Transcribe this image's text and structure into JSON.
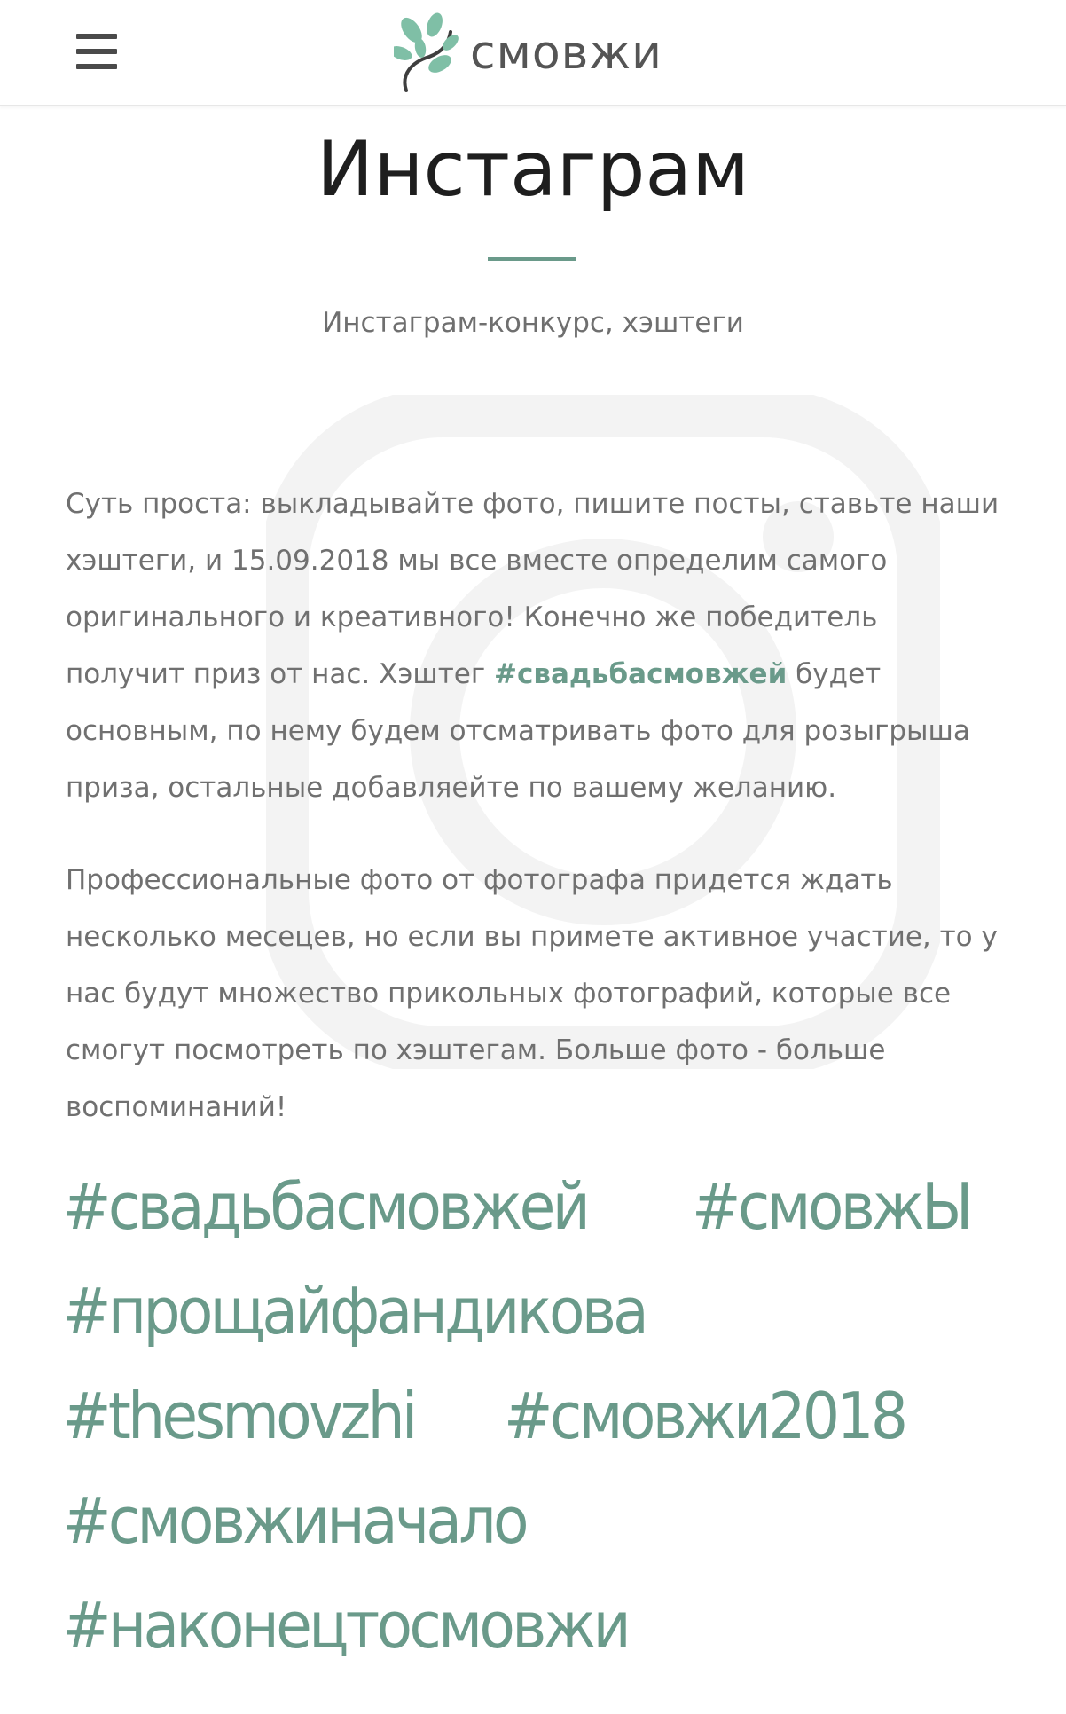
{
  "header": {
    "brand_name": "смовжи",
    "menu_icon": "hamburger-menu-icon",
    "logo_icon": "leaf-branch-icon"
  },
  "page": {
    "title": "Инстаграм",
    "subtitle": "Инстаграм-конкурс, хэштеги",
    "watermark_icon": "instagram-icon"
  },
  "intro": {
    "part1": "Суть проста: выкладывайте фото, пишите посты, ставьте наши хэштеги, и 15.09.2018 мы все вместе определим самого оригинального и креативного! Конечно же победитель получит приз от нас. Хэштег ",
    "highlight": "#свадьбасмовжей",
    "part2": " будет основным, по нему будем отсматривать фото для розыгрыша приза, остальные добавляейте по вашему желанию."
  },
  "second_paragraph": "Профессиональные фото от фотографа придется ждать несколько месецев, но если вы примете активное участие, то у нас будут множество прикольных фотографий, которые все смогут посмотреть по хэштегам. Больше фото - больше воспоминаний!",
  "hashtags": [
    "#свадьбасмовжей",
    "#смовжЫ",
    "#прощайфандикова",
    "#thesmovzhi",
    "#смовжи2018",
    "#смовжиначало",
    "#наконецтосмовжи"
  ],
  "colors": {
    "accent": "#6a9a8a",
    "text": "#707070",
    "title": "#1e1e1e",
    "watermark": "#f3f3f3"
  }
}
